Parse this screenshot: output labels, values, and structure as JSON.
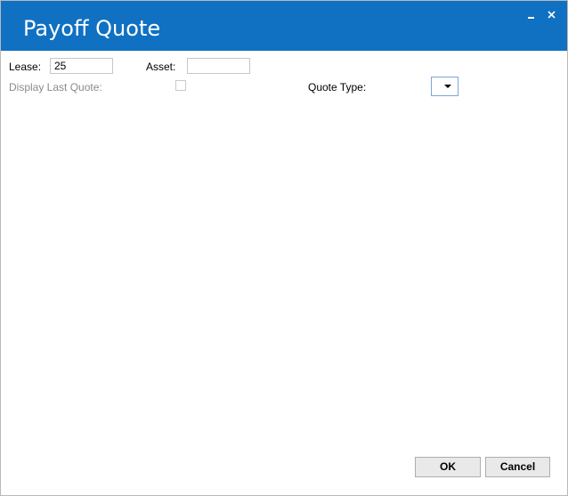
{
  "window": {
    "title": "Payoff Quote",
    "minimize_icon": "minimize-icon",
    "close_icon": "close-icon",
    "accent_color": "#1071c2"
  },
  "form": {
    "lease_label": "Lease:",
    "lease_value": "25",
    "asset_label": "Asset:",
    "asset_value": "",
    "display_last_quote_label": "Display Last Quote:",
    "display_last_quote_checked": false,
    "quote_type_label": "Quote Type:",
    "quote_type_value": ""
  },
  "footer": {
    "ok_label": "OK",
    "cancel_label": "Cancel"
  }
}
